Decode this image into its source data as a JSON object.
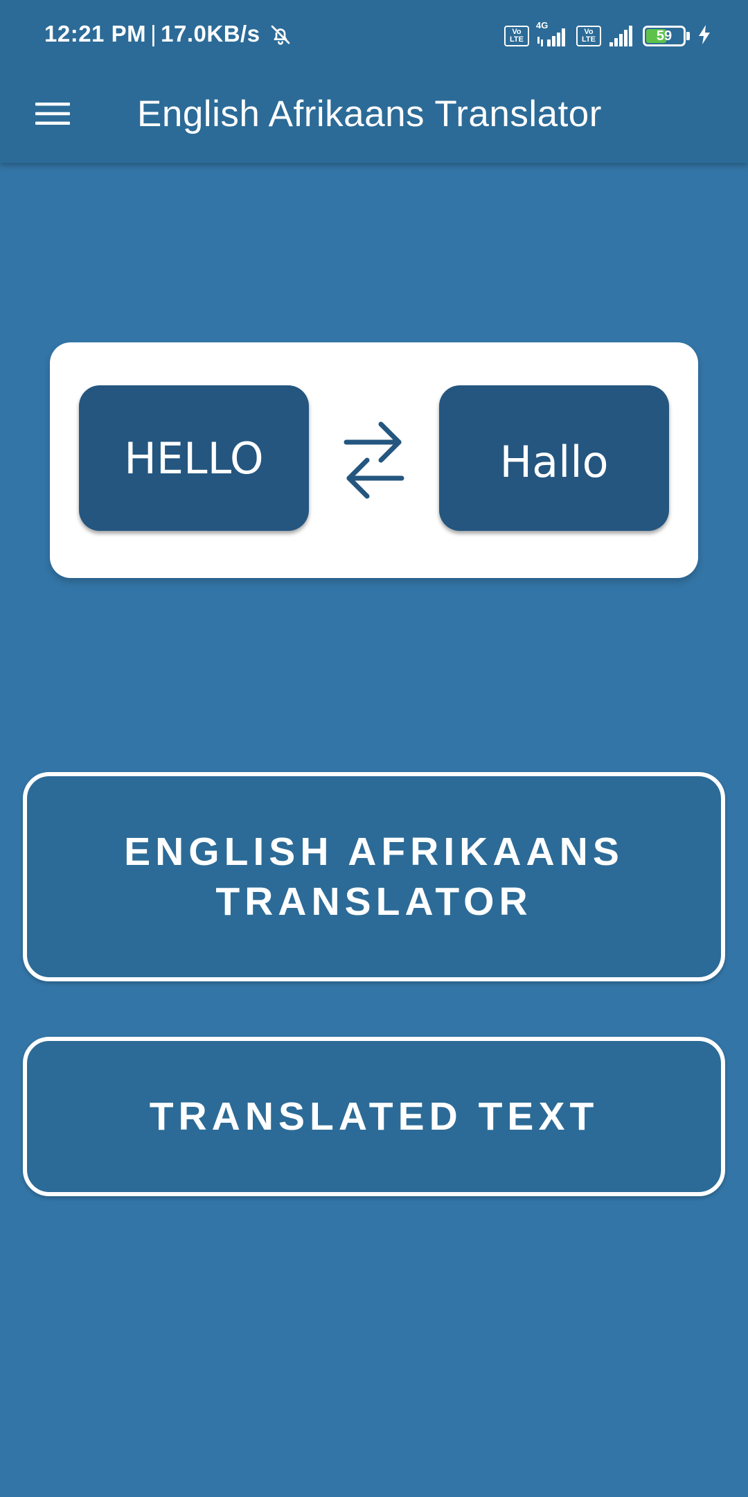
{
  "status_bar": {
    "time": "12:21 PM",
    "separator": "|",
    "net_speed": "17.0KB/s",
    "volte_label_1": "Vo\nLTE",
    "network_type": "4G",
    "battery_level": "59",
    "battery_fraction": 0.59,
    "battery_fill_color": "#5ec24a"
  },
  "app_bar": {
    "title": "English Afrikaans Translator",
    "menu_icon": "hamburger-menu-icon"
  },
  "hero": {
    "source_word": "HELLO",
    "target_word": "Hallo",
    "swap_icon": "swap-arrows-icon"
  },
  "actions": {
    "translator_button": "ENGLISH AFRIKAANS TRANSLATOR",
    "translated_text_button": "TRANSLATED TEXT"
  },
  "colors": {
    "background": "#3375a6",
    "app_bar": "#2c6b97",
    "tile": "#24567f",
    "card": "#ffffff"
  }
}
